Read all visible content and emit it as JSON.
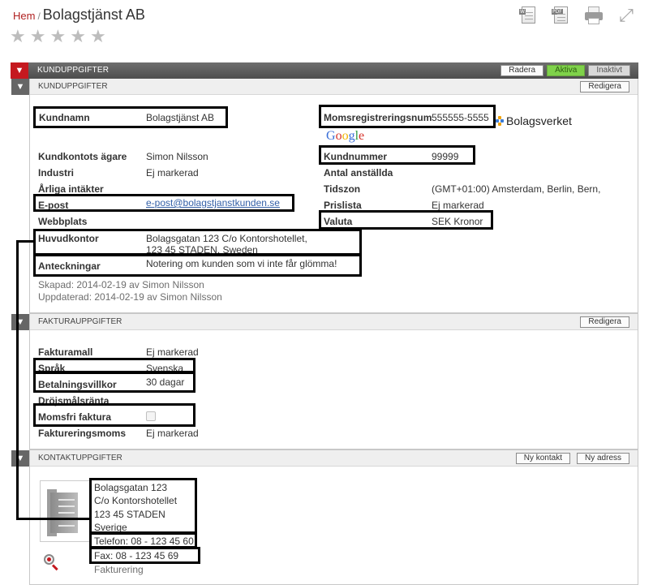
{
  "breadcrumb": {
    "home": "Hem",
    "separator": "/",
    "title": "Bolagstjänst AB"
  },
  "rating": {
    "stars": [
      "★",
      "★",
      "★",
      "★",
      "★"
    ],
    "filled": 0
  },
  "toolbar": {
    "word_tag": "W",
    "pdf_tag": "PDF",
    "fullscreen_glyph": "⤢"
  },
  "main": {
    "title": "KUNDUPPGIFTER",
    "buttons": {
      "delete": "Radera",
      "active": "Aktiva",
      "inactive": "Inaktivt"
    }
  },
  "customer": {
    "section_title": "KUNDUPPGIFTER",
    "edit": "Redigera",
    "name_label": "Kundnamn",
    "name_value": "Bolagstjänst AB",
    "owner_label": "Kundkontots ägare",
    "owner_value": "Simon Nilsson",
    "industry_label": "Industri",
    "industry_value": "Ej markerad",
    "revenue_label": "Årliga intäkter",
    "email_label": "E-post",
    "email_value": "e-post@bolagstjanstkunden.se",
    "website_label": "Webbplats",
    "hq_label": "Huvudkontor",
    "hq_line1": "Bolagsgatan 123 C/o Kontorshotellet,",
    "hq_line2": "123 45 STADEN, Sweden",
    "notes_label": "Anteckningar",
    "notes_value": "Notering om kunden som vi inte får glömma!",
    "created": "Skapad: 2014-02-19 av Simon Nilsson",
    "updated": "Uppdaterad: 2014-02-19 av Simon Nilsson",
    "vat_label": "Momsregistreringsnum",
    "vat_value": "555555-5555",
    "bolagsverket": "Bolagsverket",
    "google": [
      "G",
      "o",
      "o",
      "g",
      "l",
      "e"
    ],
    "google_colors": [
      "#3a6fd8",
      "#d6322a",
      "#f0b400",
      "#3a6fd8",
      "#2b9a3e",
      "#d6322a"
    ],
    "number_label": "Kundnummer",
    "number_value": "99999",
    "employees_label": "Antal anställda",
    "timezone_label": "Tidszon",
    "timezone_value": "(GMT+01:00) Amsterdam, Berlin, Bern,",
    "pricelist_label": "Prislista",
    "pricelist_value": "Ej markerad",
    "currency_label": "Valuta",
    "currency_value": "SEK Kronor"
  },
  "invoice": {
    "section_title": "FAKTURAUPPGIFTER",
    "edit": "Redigera",
    "template_label": "Fakturamall",
    "template_value": "Ej markerad",
    "language_label": "Språk",
    "language_value": "Svenska",
    "terms_label": "Betalningsvillkor",
    "terms_value": "30 dagar",
    "interest_label": "Dröjsmålsränta",
    "vatfree_label": "Momsfri faktura",
    "vat_label": "Faktureringsmoms",
    "vat_value": "Ej markerad"
  },
  "contact": {
    "section_title": "KONTAKTUPPGIFTER",
    "new_contact": "Ny kontakt",
    "new_address": "Ny adress",
    "address_line1": "Bolagsgatan 123",
    "address_line2": "C/o Kontorshotellet",
    "address_line3": "123 45 STADEN",
    "address_line4": "Sverige",
    "phone": "Telefon: 08 - 123 45 60",
    "fax": "Fax: 08 - 123 45 69",
    "type": "Fakturering"
  }
}
